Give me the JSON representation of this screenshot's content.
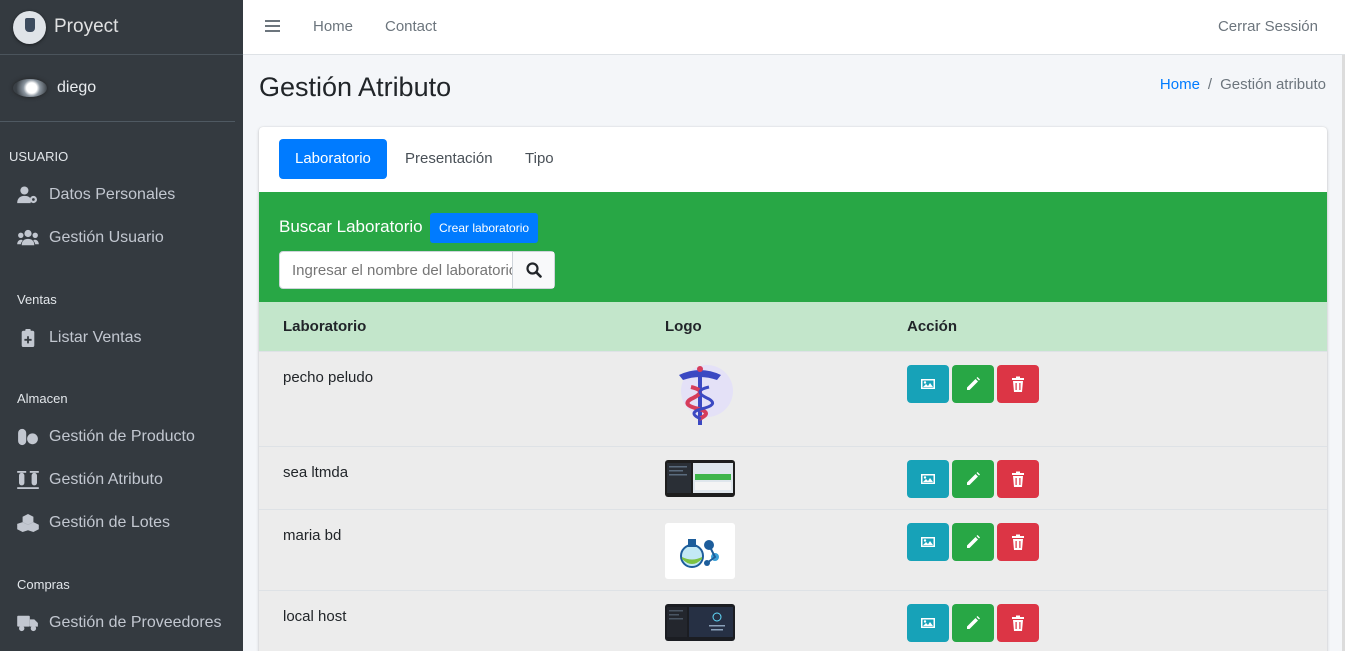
{
  "brand": {
    "name": "Proyect"
  },
  "user": {
    "name": "diego"
  },
  "sidebar": {
    "sections": [
      {
        "header": "USUARIO",
        "items": [
          {
            "label": "Datos Personales",
            "icon": "user-cog-icon"
          },
          {
            "label": "Gestión Usuario",
            "icon": "users-icon"
          }
        ]
      },
      {
        "header": "Ventas",
        "items": [
          {
            "label": "Listar Ventas",
            "icon": "clipboard-plus-icon"
          }
        ]
      },
      {
        "header": "Almacen",
        "items": [
          {
            "label": "Gestión de Producto",
            "icon": "pills-icon"
          },
          {
            "label": "Gestión Atributo",
            "icon": "vials-icon"
          },
          {
            "label": "Gestión de Lotes",
            "icon": "cubes-icon"
          }
        ]
      },
      {
        "header": "Compras",
        "items": [
          {
            "label": "Gestión de Proveedores",
            "icon": "truck-icon"
          }
        ]
      }
    ]
  },
  "topbar": {
    "links": [
      "Home",
      "Contact"
    ],
    "logout": "Cerrar Sessión"
  },
  "page": {
    "title": "Gestión Atributo",
    "breadcrumb": {
      "home": "Home",
      "current": "Gestión atributo"
    }
  },
  "tabs": [
    {
      "label": "Laboratorio",
      "active": true
    },
    {
      "label": "Presentación",
      "active": false
    },
    {
      "label": "Tipo",
      "active": false
    }
  ],
  "search": {
    "title": "Buscar Laboratorio",
    "create_label": "Crear laboratorio",
    "placeholder": "Ingresar el nombre del laboratorio"
  },
  "table": {
    "headers": [
      "Laboratorio",
      "Logo",
      "Acción"
    ],
    "rows": [
      {
        "name": "pecho peludo",
        "logo": "caduceus-logo"
      },
      {
        "name": "sea ltmda",
        "logo": "screenshot-thumbnail"
      },
      {
        "name": "maria bd",
        "logo": "flask-molecule-logo"
      },
      {
        "name": "local host",
        "logo": "dark-screenshot-thumbnail"
      }
    ]
  },
  "colors": {
    "sidebar_bg": "#343a40",
    "primary": "#007bff",
    "success": "#28a745",
    "info": "#17a2b8",
    "danger": "#dc3545",
    "table_header": "#c3e6cb"
  }
}
